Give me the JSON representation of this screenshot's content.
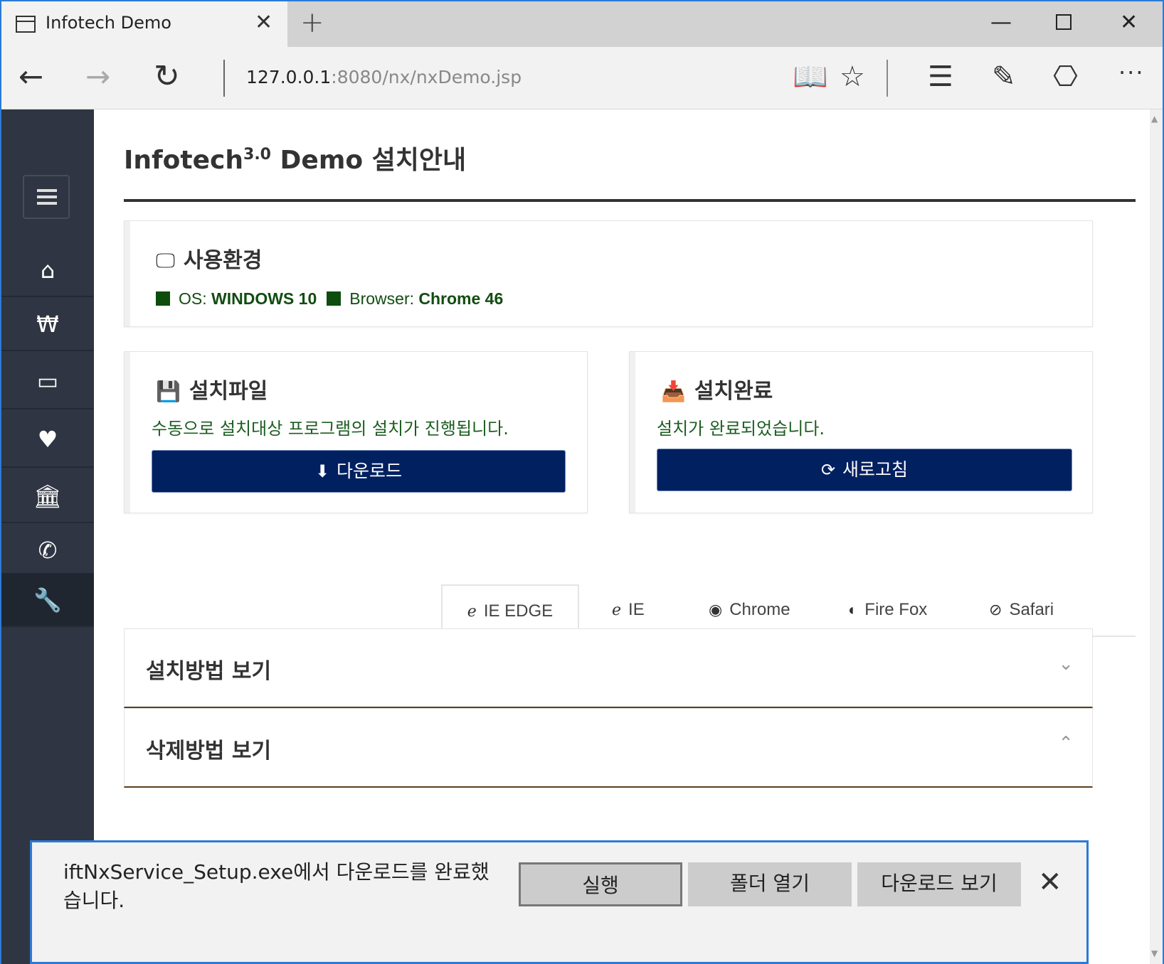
{
  "browser": {
    "tab_title": "Infotech Demo",
    "url_host": "127.0.0.1",
    "url_rest": ":8080/nx/nxDemo.jsp"
  },
  "sidebar": {
    "items": [
      {
        "icon": "home-icon"
      },
      {
        "icon": "won-icon"
      },
      {
        "icon": "card-icon"
      },
      {
        "icon": "heart-icon"
      },
      {
        "icon": "bank-icon"
      },
      {
        "icon": "phone-icon"
      },
      {
        "icon": "wrench-icon",
        "active": true
      }
    ]
  },
  "page": {
    "title_main": "Infotech",
    "title_version": "3.0",
    "title_rest": "Demo 설치안내"
  },
  "env_card": {
    "heading": "사용환경",
    "os_label": "OS:",
    "os_value": "WINDOWS 10",
    "browser_label": "Browser:",
    "browser_value": "Chrome 46"
  },
  "install_card": {
    "heading": "설치파일",
    "text": "수동으로 설치대상 프로그램의 설치가 진행됩니다.",
    "button": "다운로드"
  },
  "done_card": {
    "heading": "설치완료",
    "text": "설치가 완료되었습니다.",
    "button": "새로고침"
  },
  "browser_tabs": [
    "IE EDGE",
    "IE",
    "Chrome",
    "Fire Fox",
    "Safari"
  ],
  "accordions": [
    {
      "label": "설치방법 보기",
      "state": "collapsed"
    },
    {
      "label": "삭제방법 보기",
      "state": "expanded"
    }
  ],
  "download_bar": {
    "message": "iftNxService_Setup.exe에서 다운로드를 완료했습니다.",
    "run": "실행",
    "open_folder": "폴더 열기",
    "view_downloads": "다운로드 보기"
  },
  "colors": {
    "sidebar": "#2f3542",
    "button": "#002060",
    "status_green": "#0d4d0d",
    "accent": "#2b7bd6"
  }
}
